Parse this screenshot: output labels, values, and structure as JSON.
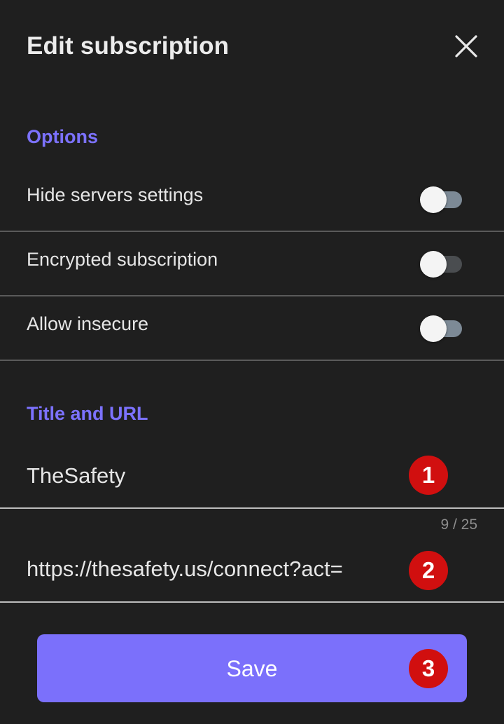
{
  "header": {
    "title": "Edit subscription",
    "close_icon": "close-icon"
  },
  "options": {
    "section_title": "Options",
    "items": [
      {
        "label": "Hide servers settings",
        "enabled": false,
        "track_color": "#7d8a96"
      },
      {
        "label": "Encrypted subscription",
        "enabled": false,
        "track_color": "#4a4d50"
      },
      {
        "label": "Allow insecure",
        "enabled": false,
        "track_color": "#7d8a96"
      }
    ]
  },
  "title_url": {
    "section_title": "Title and URL",
    "title_value": "TheSafety",
    "title_counter": "9 / 25",
    "url_value": "https://thesafety.us/connect?act="
  },
  "badges": [
    "1",
    "2",
    "3"
  ],
  "save_button": {
    "label": "Save"
  },
  "colors": {
    "accent": "#7b70fb",
    "section_title": "#7c72ff",
    "background": "#1f1f1f",
    "badge": "#d10f0f"
  }
}
